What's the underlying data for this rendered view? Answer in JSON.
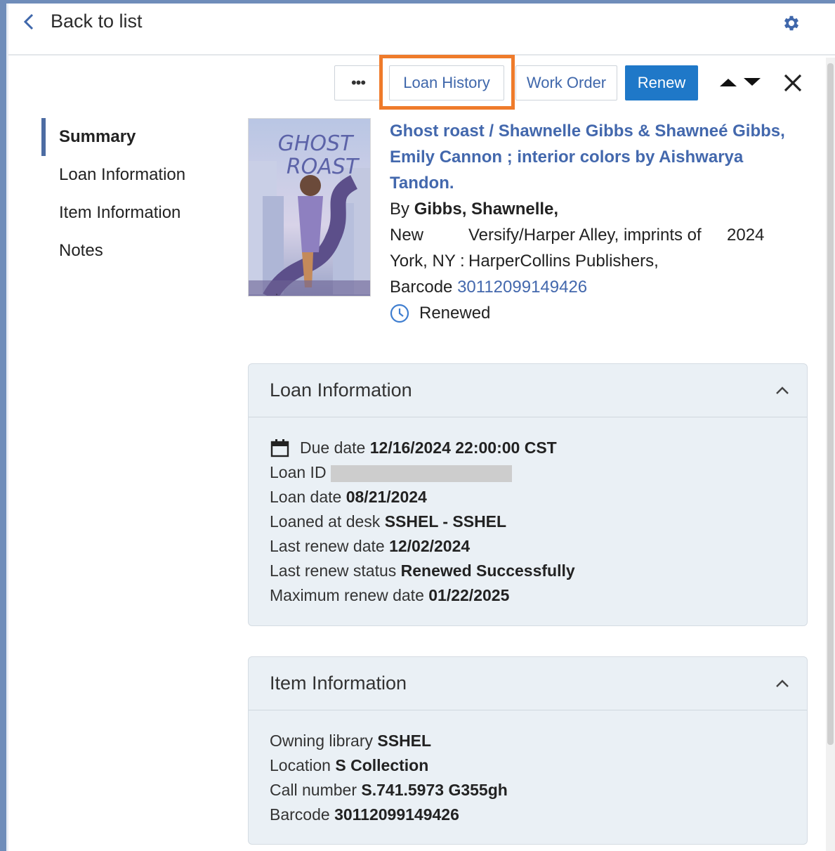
{
  "header": {
    "back_label": "Back to list"
  },
  "toolbar": {
    "more_label": "•••",
    "loan_history_label": "Loan History",
    "work_order_label": "Work Order",
    "renew_label": "Renew"
  },
  "sidenav": {
    "items": [
      {
        "label": "Summary"
      },
      {
        "label": "Loan Information"
      },
      {
        "label": "Item Information"
      },
      {
        "label": "Notes"
      }
    ]
  },
  "summary": {
    "title_line1": "Ghost roast / Shawnelle Gibbs & Shawneé Gibbs,",
    "title_line2": "Emily Cannon ; interior colors by Aishwarya Tandon.",
    "by_prefix": "By",
    "author": "Gibbs, Shawnelle,",
    "pub_place_line1": "New",
    "pub_place_line2": "York, NY :",
    "publisher_line1": "Versify/Harper Alley, imprints of",
    "publisher_line2": "HarperCollins Publishers,",
    "year": "2024",
    "barcode_prefix": "Barcode",
    "barcode": "30112099149426",
    "status": "Renewed"
  },
  "cover": {
    "title_line1": "GHOST",
    "title_line2": "ROAST",
    "accent_colors": [
      "#b9c6e4",
      "#7f6aa8",
      "#c48a5a"
    ]
  },
  "loan_info": {
    "heading": "Loan Information",
    "due_label": "Due date",
    "due_value": "12/16/2024 22:00:00 CST",
    "loan_id_label": "Loan ID",
    "loan_date_label": "Loan date",
    "loan_date_value": "08/21/2024",
    "desk_label": "Loaned at desk",
    "desk_value": "SSHEL - SSHEL",
    "last_renew_label": "Last renew date",
    "last_renew_value": "12/02/2024",
    "renew_status_label": "Last renew status",
    "renew_status_value": "Renewed Successfully",
    "max_renew_label": "Maximum renew date",
    "max_renew_value": "01/22/2025"
  },
  "item_info": {
    "heading": "Item Information",
    "library_label": "Owning library",
    "library_value": "SSHEL",
    "location_label": "Location",
    "location_value": "S Collection",
    "call_label": "Call number",
    "call_value": "S.741.5973 G355gh",
    "barcode_label": "Barcode",
    "barcode_value": "30112099149426"
  },
  "colors": {
    "accent": "#1f78c8",
    "link": "#4368ad",
    "highlight": "#ef7b2b",
    "frame": "#6f8dba"
  }
}
